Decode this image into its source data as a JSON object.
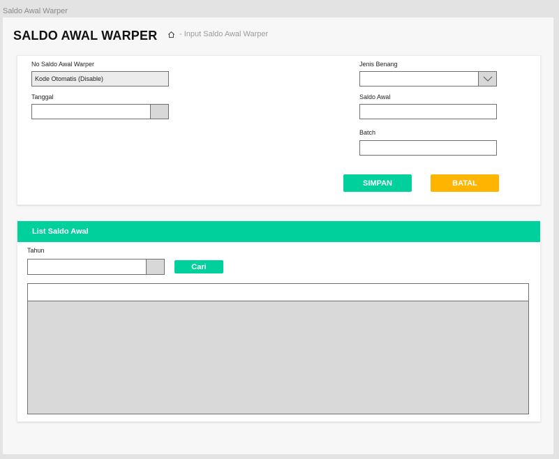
{
  "frame_label": "Saldo Awal Warper",
  "header": {
    "title": "SALDO AWAL WARPER",
    "breadcrumb": "- Input Saldo Awal Warper",
    "home_icon": "home-icon"
  },
  "form": {
    "no_saldo_label": "No Saldo Awal Warper",
    "no_saldo_value": "Kode Otomatis (Disable)",
    "tanggal_label": "Tanggal",
    "tanggal_value": "",
    "jenis_benang_label": "Jenis Benang",
    "jenis_benang_value": "",
    "saldo_awal_label": "Saldo Awal",
    "saldo_awal_value": "",
    "batch_label": "Batch",
    "batch_value": "",
    "simpan_label": "SIMPAN",
    "batal_label": "BATAL"
  },
  "list": {
    "header": "List Saldo Awal",
    "tahun_label": "Tahun",
    "tahun_value": "",
    "cari_label": "Cari"
  },
  "colors": {
    "accent": "#00d19c",
    "warning": "#ffb400"
  }
}
